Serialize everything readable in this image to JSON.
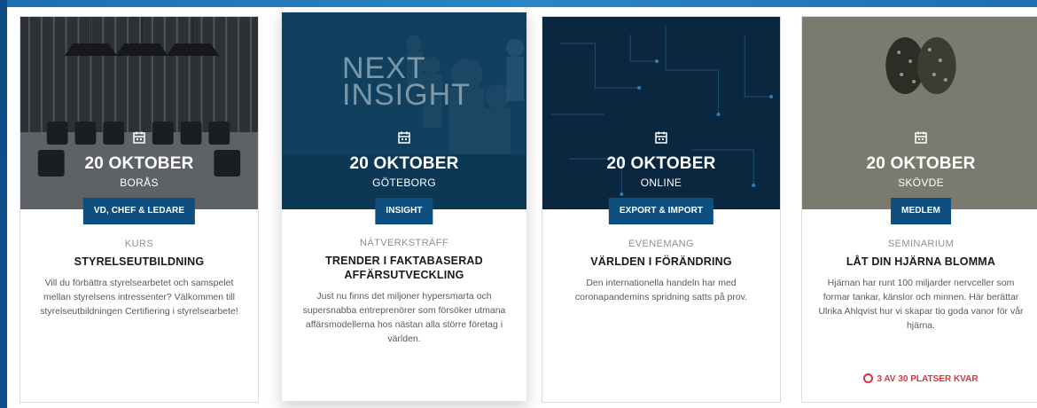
{
  "colors": {
    "tag_bg": "#0f4f7f",
    "seats_red": "#d9343b",
    "page_blue": "#1565a8"
  },
  "cards": [
    {
      "date": "20 OKTOBER",
      "city": "BORÅS",
      "tag": "VD, CHEF & LEDARE",
      "type": "KURS",
      "title": "STYRELSEUTBILDNING",
      "desc": "Vill du förbättra styrelsearbetet och samspelet mellan styrelsens intressenter? Välkommen till styrelseutbildningen Certifiering i styrelsearbete!",
      "icon": "calendar-icon"
    },
    {
      "date": "20 OKTOBER",
      "city": "GÖTEBORG",
      "tag": "INSIGHT",
      "type": "NÄTVERKSTRÄFF",
      "title": "TRENDER I FAKTABASERAD AFFÄRSUTVECKLING",
      "desc": "Just nu finns det miljoner hypersmarta och supersnabba entreprenörer som försöker utmana affärsmodellerna hos nästan alla större företag i världen.",
      "hero_text_1": "NEXT",
      "hero_text_2": "INSIGHT",
      "icon": "calendar-icon"
    },
    {
      "date": "20 OKTOBER",
      "city": "ONLINE",
      "tag": "EXPORT & IMPORT",
      "type": "EVENEMANG",
      "title": "VÄRLDEN I FÖRÄNDRING",
      "desc": "Den internationella handeln har med coronapandemins spridning satts på prov.",
      "icon": "calendar-icon"
    },
    {
      "date": "20 OKTOBER",
      "city": "SKÖVDE",
      "tag": "MEDLEM",
      "type": "SEMINARIUM",
      "title": "LÅT DIN HJÄRNA BLOMMA",
      "desc": "Hjärnan har runt 100 miljarder nervceller som formar tankar, känslor och minnen. Här berättar Ulrika Ahlqvist hur vi skapar tio goda vanor för vår hjärna.",
      "seats": "3 AV 30 PLATSER KVAR",
      "icon": "calendar-icon"
    }
  ]
}
